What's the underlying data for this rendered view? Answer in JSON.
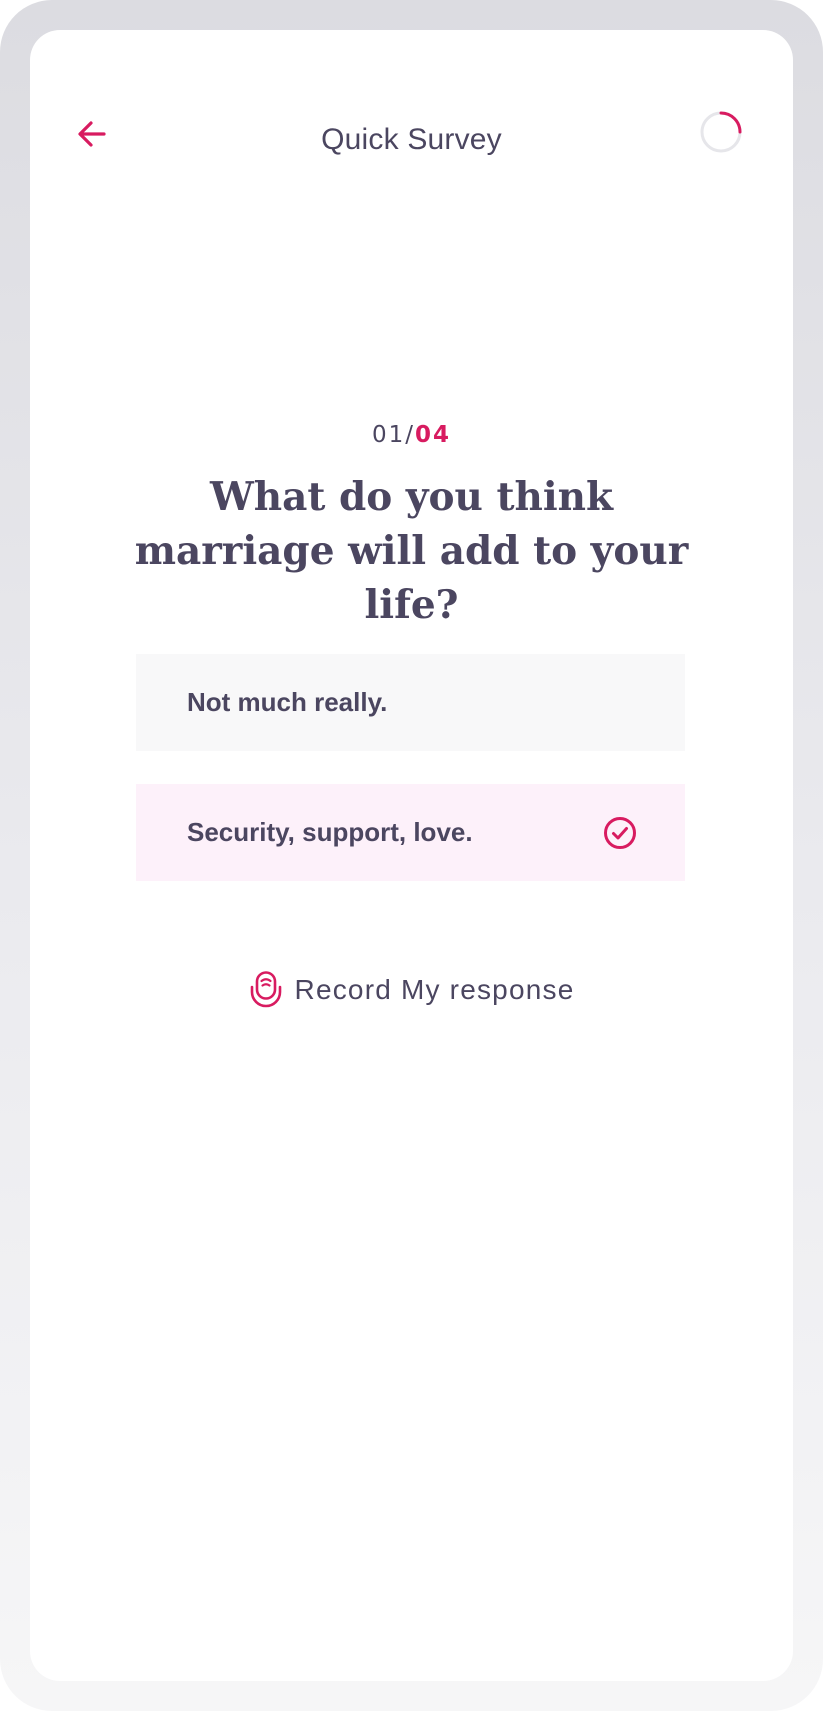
{
  "header": {
    "title": "Quick Survey",
    "back_icon": "arrow-left-icon",
    "progress_icon": "progress-ring-icon",
    "progress_fraction": 0.25
  },
  "question": {
    "current": "01/",
    "total": "04",
    "text": "What do you think marriage will add to your life?"
  },
  "options": [
    {
      "label": "Not much really.",
      "selected": false
    },
    {
      "label": "Security, support, love.",
      "selected": true,
      "icon": "check-circle-icon"
    }
  ],
  "record": {
    "icon": "microphone-icon",
    "label": "Record My response"
  },
  "colors": {
    "accent": "#d81b60",
    "text": "#4b4660",
    "selected_bg": "#fdf1fa",
    "option_bg": "#f8f8f9"
  }
}
